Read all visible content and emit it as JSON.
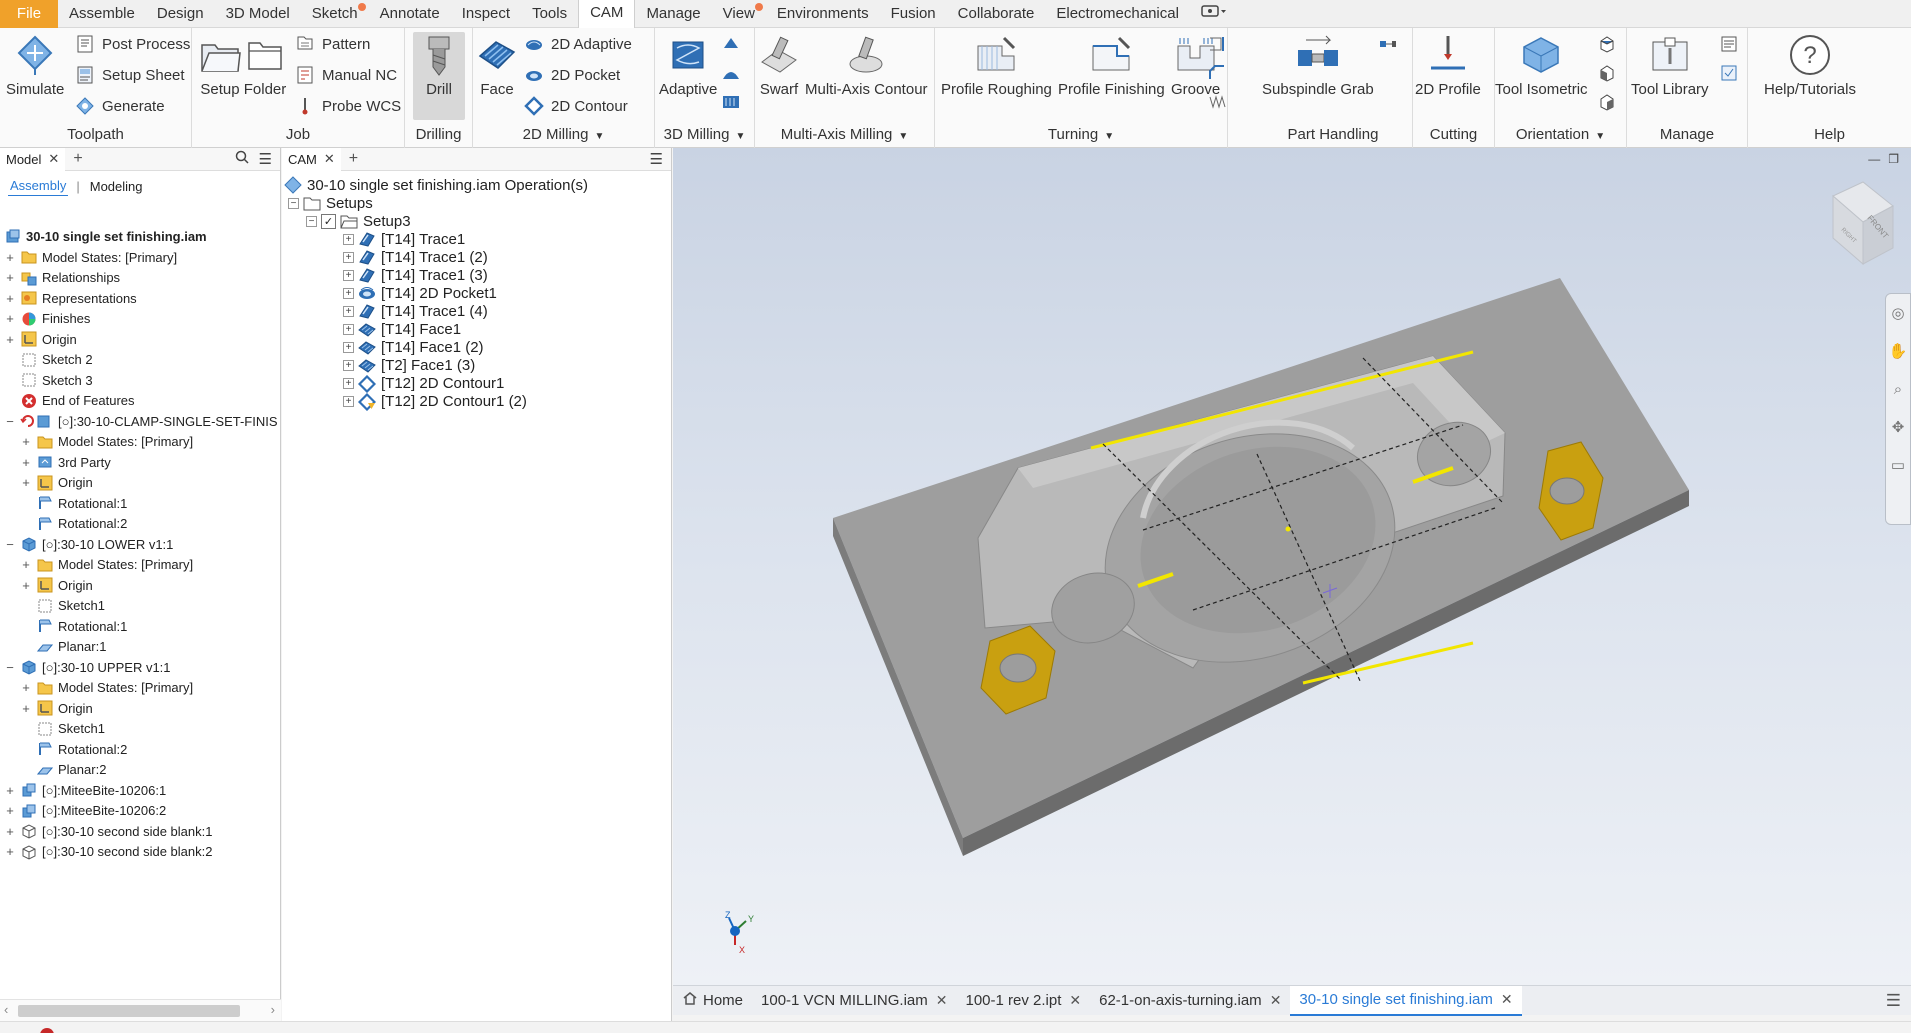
{
  "menu": {
    "tabs": [
      "File",
      "Assemble",
      "Design",
      "3D Model",
      "Sketch",
      "Annotate",
      "Inspect",
      "Tools",
      "CAM",
      "Manage",
      "View",
      "Environments",
      "Fusion",
      "Collaborate",
      "Electromechanical"
    ],
    "active": "CAM",
    "extra_icon": "screen-dropdown-icon"
  },
  "ribbon": {
    "toolpath": {
      "label": "Toolpath",
      "simulate": "Simulate",
      "post_process": "Post Process",
      "setup_sheet": "Setup Sheet",
      "generate": "Generate"
    },
    "job": {
      "label": "Job",
      "setup": "Setup",
      "folder": "Folder",
      "pattern": "Pattern",
      "manual_nc": "Manual NC",
      "probe_wcs": "Probe WCS"
    },
    "drilling": {
      "label": "Drilling",
      "drill": "Drill"
    },
    "milling_2d": {
      "label": "2D Milling",
      "face": "Face",
      "adaptive_2d": "2D Adaptive",
      "pocket_2d": "2D Pocket",
      "contour_2d": "2D Contour"
    },
    "milling_3d": {
      "label": "3D Milling",
      "adaptive": "Adaptive"
    },
    "multi_axis": {
      "label": "Multi-Axis Milling",
      "swarf": "Swarf",
      "multi_axis_contour": "Multi-Axis Contour"
    },
    "turning": {
      "label": "Turning",
      "profile_roughing": "Profile Roughing",
      "profile_finishing": "Profile Finishing",
      "groove": "Groove"
    },
    "part_handling": {
      "label": "Part Handling",
      "subspindle_grab": "Subspindle Grab"
    },
    "cutting": {
      "label": "Cutting",
      "profile_2d": "2D Profile"
    },
    "orientation": {
      "label": "Orientation",
      "tool_isometric": "Tool Isometric"
    },
    "manage": {
      "label": "Manage",
      "tool_library": "Tool Library"
    },
    "help": {
      "label": "Help",
      "help_tutorials": "Help/Tutorials"
    }
  },
  "model_panel": {
    "tab": "Model",
    "subtabs": [
      "Assembly",
      "Modeling"
    ],
    "root": "30-10 single set finishing.iam",
    "items": [
      {
        "label": "Model States: [Primary]",
        "indent": 0,
        "icon": "folder-icon",
        "exp": "+"
      },
      {
        "label": "Relationships",
        "indent": 0,
        "icon": "relationships-icon",
        "exp": "+"
      },
      {
        "label": "Representations",
        "indent": 0,
        "icon": "representations-icon",
        "exp": "+"
      },
      {
        "label": "Finishes",
        "indent": 0,
        "icon": "finishes-icon",
        "exp": "+"
      },
      {
        "label": "Origin",
        "indent": 0,
        "icon": "origin-icon",
        "exp": "+"
      },
      {
        "label": "Sketch 2",
        "indent": 0,
        "icon": "sketch-icon",
        "exp": ""
      },
      {
        "label": "Sketch 3",
        "indent": 0,
        "icon": "sketch-icon",
        "exp": ""
      },
      {
        "label": "End of Features",
        "indent": 0,
        "icon": "end-of-features-icon",
        "exp": ""
      },
      {
        "label": "[○]:30-10-CLAMP-SINGLE-SET-FINIS",
        "indent": 0,
        "icon": "part-refresh-icon",
        "exp": "−"
      },
      {
        "label": "Model States: [Primary]",
        "indent": 1,
        "icon": "folder-icon",
        "exp": "+"
      },
      {
        "label": "3rd Party",
        "indent": 1,
        "icon": "third-party-icon",
        "exp": "+"
      },
      {
        "label": "Origin",
        "indent": 1,
        "icon": "origin-icon",
        "exp": "+"
      },
      {
        "label": "Rotational:1",
        "indent": 1,
        "icon": "rotational-icon",
        "exp": ""
      },
      {
        "label": "Rotational:2",
        "indent": 1,
        "icon": "rotational-icon",
        "exp": ""
      },
      {
        "label": "[○]:30-10 LOWER v1:1",
        "indent": 0,
        "icon": "part-icon",
        "exp": "−"
      },
      {
        "label": "Model States: [Primary]",
        "indent": 1,
        "icon": "folder-icon",
        "exp": "+"
      },
      {
        "label": "Origin",
        "indent": 1,
        "icon": "origin-icon",
        "exp": "+"
      },
      {
        "label": "Sketch1",
        "indent": 1,
        "icon": "sketch-icon",
        "exp": ""
      },
      {
        "label": "Rotational:1",
        "indent": 1,
        "icon": "rotational-icon",
        "exp": ""
      },
      {
        "label": "Planar:1",
        "indent": 1,
        "icon": "planar-icon",
        "exp": ""
      },
      {
        "label": "[○]:30-10 UPPER v1:1",
        "indent": 0,
        "icon": "part-icon",
        "exp": "−"
      },
      {
        "label": "Model States: [Primary]",
        "indent": 1,
        "icon": "folder-icon",
        "exp": "+"
      },
      {
        "label": "Origin",
        "indent": 1,
        "icon": "origin-icon",
        "exp": "+"
      },
      {
        "label": "Sketch1",
        "indent": 1,
        "icon": "sketch-icon",
        "exp": ""
      },
      {
        "label": "Rotational:2",
        "indent": 1,
        "icon": "rotational-icon",
        "exp": ""
      },
      {
        "label": "Planar:2",
        "indent": 1,
        "icon": "planar-icon",
        "exp": ""
      },
      {
        "label": "[○]:MiteeBite-10206:1",
        "indent": 0,
        "icon": "assembly-icon",
        "exp": "+"
      },
      {
        "label": "[○]:MiteeBite-10206:2",
        "indent": 0,
        "icon": "assembly-icon",
        "exp": "+"
      },
      {
        "label": "[○]:30-10 second side blank:1",
        "indent": 0,
        "icon": "blank-icon",
        "exp": "+"
      },
      {
        "label": "[○]:30-10 second side blank:2",
        "indent": 0,
        "icon": "blank-icon",
        "exp": "+"
      }
    ]
  },
  "cam_panel": {
    "tab": "CAM",
    "root": "30-10 single set finishing.iam Operation(s)",
    "setups_label": "Setups",
    "setup_label": "Setup3",
    "operations": [
      {
        "label": "[T14] Trace1",
        "icon": "trace-icon"
      },
      {
        "label": "[T14] Trace1 (2)",
        "icon": "trace-icon"
      },
      {
        "label": "[T14] Trace1 (3)",
        "icon": "trace-icon"
      },
      {
        "label": "[T14] 2D Pocket1",
        "icon": "pocket-icon"
      },
      {
        "label": "[T14] Trace1 (4)",
        "icon": "trace-icon"
      },
      {
        "label": "[T14] Face1",
        "icon": "face-icon"
      },
      {
        "label": "[T14] Face1 (2)",
        "icon": "face-icon"
      },
      {
        "label": "[T2] Face1 (3)",
        "icon": "face-icon"
      },
      {
        "label": "[T12] 2D Contour1",
        "icon": "contour-icon"
      },
      {
        "label": "[T12] 2D Contour1 (2)",
        "icon": "contour-warning-icon"
      }
    ]
  },
  "viewcube": {
    "face_label": "FRONT",
    "side_label": "RIGHT"
  },
  "doc_tabs": [
    {
      "label": "Home",
      "closable": false
    },
    {
      "label": "100-1 VCN MILLING.iam",
      "closable": true
    },
    {
      "label": "100-1 rev 2.ipt",
      "closable": true
    },
    {
      "label": "62-1-on-axis-turning.iam",
      "closable": true
    },
    {
      "label": "30-10 single set finishing.iam",
      "closable": true,
      "active": true
    }
  ],
  "colors": {
    "accent": "#2a7bd6",
    "file_tab": "#f0a12a",
    "model_grey": "#9a9a9a",
    "highlight_yellow": "#f2e600",
    "clamp_gold": "#c9a010"
  }
}
